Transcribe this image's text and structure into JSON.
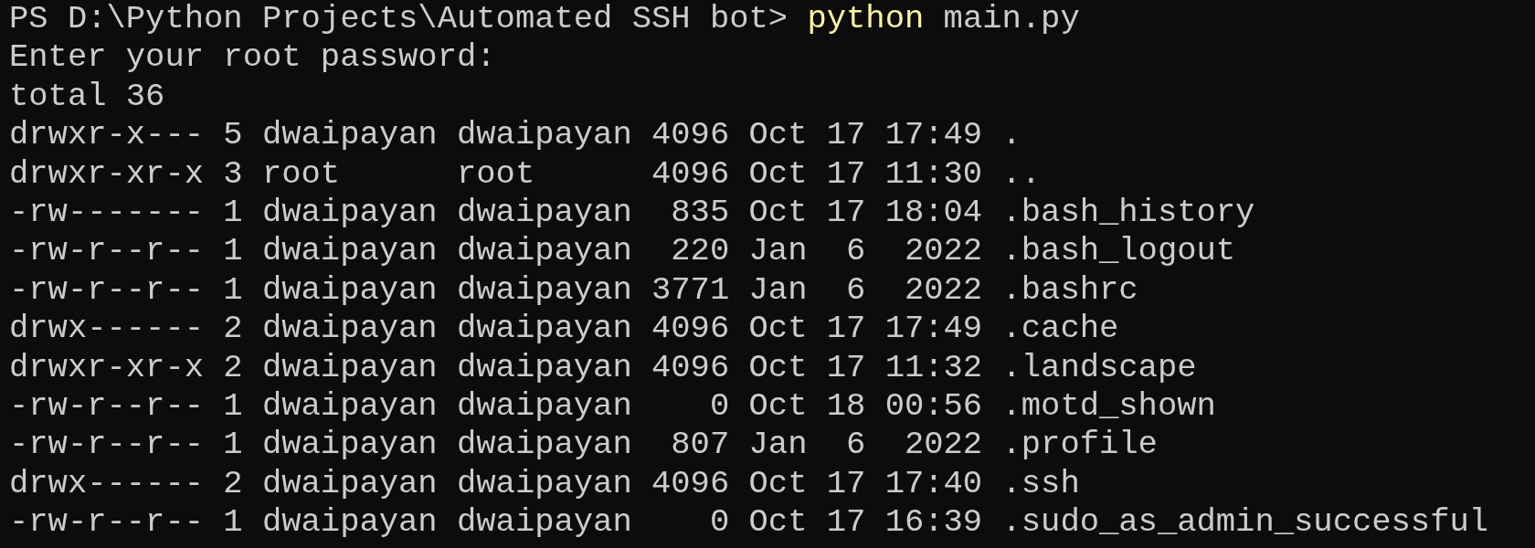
{
  "terminal": {
    "lines": [
      {
        "segments": [
          {
            "kind": "prompt",
            "text": "PS D:\\Python Projects\\Automated SSH bot> "
          },
          {
            "kind": "command",
            "text": "python"
          },
          {
            "kind": "output",
            "text": " main.py"
          }
        ]
      },
      {
        "segments": [
          {
            "kind": "output",
            "text": "Enter your root password:"
          }
        ]
      },
      {
        "segments": [
          {
            "kind": "output",
            "text": "total 36"
          }
        ]
      },
      {
        "segments": [
          {
            "kind": "output",
            "text": "drwxr-x--- 5 dwaipayan dwaipayan 4096 Oct 17 17:49 ."
          }
        ]
      },
      {
        "segments": [
          {
            "kind": "output",
            "text": "drwxr-xr-x 3 root      root      4096 Oct 17 11:30 .."
          }
        ]
      },
      {
        "segments": [
          {
            "kind": "output",
            "text": "-rw------- 1 dwaipayan dwaipayan  835 Oct 17 18:04 .bash_history"
          }
        ]
      },
      {
        "segments": [
          {
            "kind": "output",
            "text": "-rw-r--r-- 1 dwaipayan dwaipayan  220 Jan  6  2022 .bash_logout"
          }
        ]
      },
      {
        "segments": [
          {
            "kind": "output",
            "text": "-rw-r--r-- 1 dwaipayan dwaipayan 3771 Jan  6  2022 .bashrc"
          }
        ]
      },
      {
        "segments": [
          {
            "kind": "output",
            "text": "drwx------ 2 dwaipayan dwaipayan 4096 Oct 17 17:49 .cache"
          }
        ]
      },
      {
        "segments": [
          {
            "kind": "output",
            "text": "drwxr-xr-x 2 dwaipayan dwaipayan 4096 Oct 17 11:32 .landscape"
          }
        ]
      },
      {
        "segments": [
          {
            "kind": "output",
            "text": "-rw-r--r-- 1 dwaipayan dwaipayan    0 Oct 18 00:56 .motd_shown"
          }
        ]
      },
      {
        "segments": [
          {
            "kind": "output",
            "text": "-rw-r--r-- 1 dwaipayan dwaipayan  807 Jan  6  2022 .profile"
          }
        ]
      },
      {
        "segments": [
          {
            "kind": "output",
            "text": "drwx------ 2 dwaipayan dwaipayan 4096 Oct 17 17:40 .ssh"
          }
        ]
      },
      {
        "segments": [
          {
            "kind": "output",
            "text": "-rw-r--r-- 1 dwaipayan dwaipayan    0 Oct 17 16:39 .sudo_as_admin_successful"
          }
        ]
      }
    ]
  }
}
